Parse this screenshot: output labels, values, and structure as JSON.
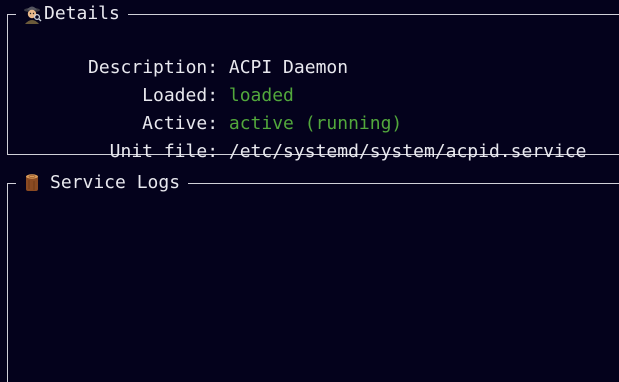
{
  "details": {
    "title": "Details",
    "icon": "detective-icon",
    "rows": [
      {
        "label": "Description:",
        "value": "ACPI Daemon"
      },
      {
        "label": "Loaded:",
        "value": "loaded"
      },
      {
        "label": "Active:",
        "value": "active (running)"
      },
      {
        "label": "Unit file:",
        "value": "/etc/systemd/system/acpid.service"
      }
    ]
  },
  "logs": {
    "title": "Service Logs",
    "icon": "log-wood-icon"
  },
  "colors": {
    "background": "#04021c",
    "text": "#e8e8ee",
    "status_green": "#52a83c",
    "border": "#d0d0d8"
  }
}
